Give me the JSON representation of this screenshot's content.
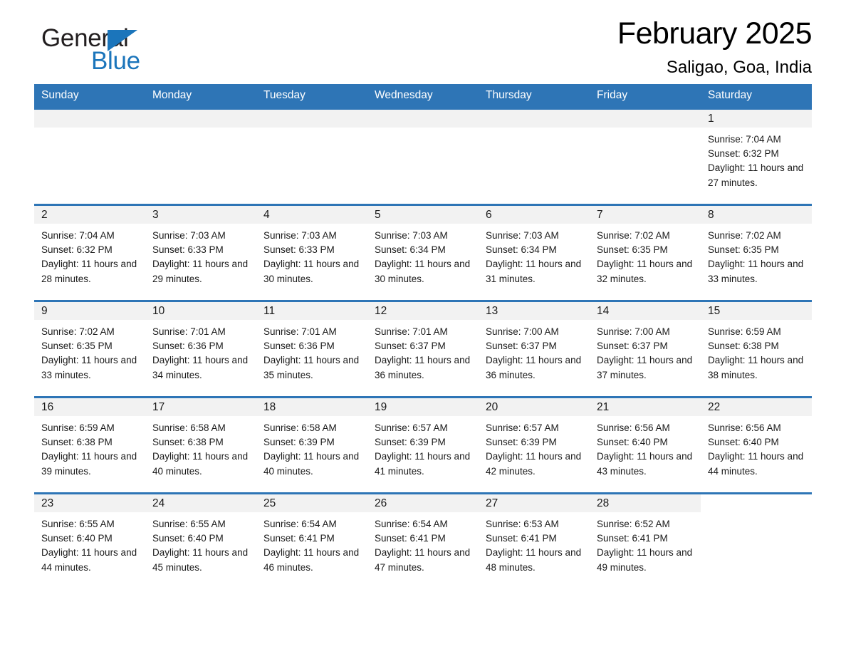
{
  "brand": {
    "name_part1": "General",
    "name_part2": "Blue",
    "triangle_color": "#1b75bb"
  },
  "header": {
    "title": "February 2025",
    "location": "Saligao, Goa, India",
    "header_bg": "#2e75b6",
    "row_border": "#2e75b6",
    "daynum_bg": "#f2f2f2"
  },
  "weekday_headers": [
    "Sunday",
    "Monday",
    "Tuesday",
    "Wednesday",
    "Thursday",
    "Friday",
    "Saturday"
  ],
  "labels": {
    "sunrise_prefix": "Sunrise:",
    "sunset_prefix": "Sunset:",
    "daylight_prefix": "Daylight:"
  },
  "weeks": [
    [
      {
        "day": "",
        "empty": true
      },
      {
        "day": "",
        "empty": true
      },
      {
        "day": "",
        "empty": true
      },
      {
        "day": "",
        "empty": true
      },
      {
        "day": "",
        "empty": true
      },
      {
        "day": "",
        "empty": true
      },
      {
        "day": "1",
        "sunrise": "Sunrise: 7:04 AM",
        "sunset": "Sunset: 6:32 PM",
        "daylight": "Daylight: 11 hours and 27 minutes."
      }
    ],
    [
      {
        "day": "2",
        "sunrise": "Sunrise: 7:04 AM",
        "sunset": "Sunset: 6:32 PM",
        "daylight": "Daylight: 11 hours and 28 minutes."
      },
      {
        "day": "3",
        "sunrise": "Sunrise: 7:03 AM",
        "sunset": "Sunset: 6:33 PM",
        "daylight": "Daylight: 11 hours and 29 minutes."
      },
      {
        "day": "4",
        "sunrise": "Sunrise: 7:03 AM",
        "sunset": "Sunset: 6:33 PM",
        "daylight": "Daylight: 11 hours and 30 minutes."
      },
      {
        "day": "5",
        "sunrise": "Sunrise: 7:03 AM",
        "sunset": "Sunset: 6:34 PM",
        "daylight": "Daylight: 11 hours and 30 minutes."
      },
      {
        "day": "6",
        "sunrise": "Sunrise: 7:03 AM",
        "sunset": "Sunset: 6:34 PM",
        "daylight": "Daylight: 11 hours and 31 minutes."
      },
      {
        "day": "7",
        "sunrise": "Sunrise: 7:02 AM",
        "sunset": "Sunset: 6:35 PM",
        "daylight": "Daylight: 11 hours and 32 minutes."
      },
      {
        "day": "8",
        "sunrise": "Sunrise: 7:02 AM",
        "sunset": "Sunset: 6:35 PM",
        "daylight": "Daylight: 11 hours and 33 minutes."
      }
    ],
    [
      {
        "day": "9",
        "sunrise": "Sunrise: 7:02 AM",
        "sunset": "Sunset: 6:35 PM",
        "daylight": "Daylight: 11 hours and 33 minutes."
      },
      {
        "day": "10",
        "sunrise": "Sunrise: 7:01 AM",
        "sunset": "Sunset: 6:36 PM",
        "daylight": "Daylight: 11 hours and 34 minutes."
      },
      {
        "day": "11",
        "sunrise": "Sunrise: 7:01 AM",
        "sunset": "Sunset: 6:36 PM",
        "daylight": "Daylight: 11 hours and 35 minutes."
      },
      {
        "day": "12",
        "sunrise": "Sunrise: 7:01 AM",
        "sunset": "Sunset: 6:37 PM",
        "daylight": "Daylight: 11 hours and 36 minutes."
      },
      {
        "day": "13",
        "sunrise": "Sunrise: 7:00 AM",
        "sunset": "Sunset: 6:37 PM",
        "daylight": "Daylight: 11 hours and 36 minutes."
      },
      {
        "day": "14",
        "sunrise": "Sunrise: 7:00 AM",
        "sunset": "Sunset: 6:37 PM",
        "daylight": "Daylight: 11 hours and 37 minutes."
      },
      {
        "day": "15",
        "sunrise": "Sunrise: 6:59 AM",
        "sunset": "Sunset: 6:38 PM",
        "daylight": "Daylight: 11 hours and 38 minutes."
      }
    ],
    [
      {
        "day": "16",
        "sunrise": "Sunrise: 6:59 AM",
        "sunset": "Sunset: 6:38 PM",
        "daylight": "Daylight: 11 hours and 39 minutes."
      },
      {
        "day": "17",
        "sunrise": "Sunrise: 6:58 AM",
        "sunset": "Sunset: 6:38 PM",
        "daylight": "Daylight: 11 hours and 40 minutes."
      },
      {
        "day": "18",
        "sunrise": "Sunrise: 6:58 AM",
        "sunset": "Sunset: 6:39 PM",
        "daylight": "Daylight: 11 hours and 40 minutes."
      },
      {
        "day": "19",
        "sunrise": "Sunrise: 6:57 AM",
        "sunset": "Sunset: 6:39 PM",
        "daylight": "Daylight: 11 hours and 41 minutes."
      },
      {
        "day": "20",
        "sunrise": "Sunrise: 6:57 AM",
        "sunset": "Sunset: 6:39 PM",
        "daylight": "Daylight: 11 hours and 42 minutes."
      },
      {
        "day": "21",
        "sunrise": "Sunrise: 6:56 AM",
        "sunset": "Sunset: 6:40 PM",
        "daylight": "Daylight: 11 hours and 43 minutes."
      },
      {
        "day": "22",
        "sunrise": "Sunrise: 6:56 AM",
        "sunset": "Sunset: 6:40 PM",
        "daylight": "Daylight: 11 hours and 44 minutes."
      }
    ],
    [
      {
        "day": "23",
        "sunrise": "Sunrise: 6:55 AM",
        "sunset": "Sunset: 6:40 PM",
        "daylight": "Daylight: 11 hours and 44 minutes."
      },
      {
        "day": "24",
        "sunrise": "Sunrise: 6:55 AM",
        "sunset": "Sunset: 6:40 PM",
        "daylight": "Daylight: 11 hours and 45 minutes."
      },
      {
        "day": "25",
        "sunrise": "Sunrise: 6:54 AM",
        "sunset": "Sunset: 6:41 PM",
        "daylight": "Daylight: 11 hours and 46 minutes."
      },
      {
        "day": "26",
        "sunrise": "Sunrise: 6:54 AM",
        "sunset": "Sunset: 6:41 PM",
        "daylight": "Daylight: 11 hours and 47 minutes."
      },
      {
        "day": "27",
        "sunrise": "Sunrise: 6:53 AM",
        "sunset": "Sunset: 6:41 PM",
        "daylight": "Daylight: 11 hours and 48 minutes."
      },
      {
        "day": "28",
        "sunrise": "Sunrise: 6:52 AM",
        "sunset": "Sunset: 6:41 PM",
        "daylight": "Daylight: 11 hours and 49 minutes."
      },
      {
        "day": "",
        "empty": true,
        "blank_tail": true
      }
    ]
  ]
}
